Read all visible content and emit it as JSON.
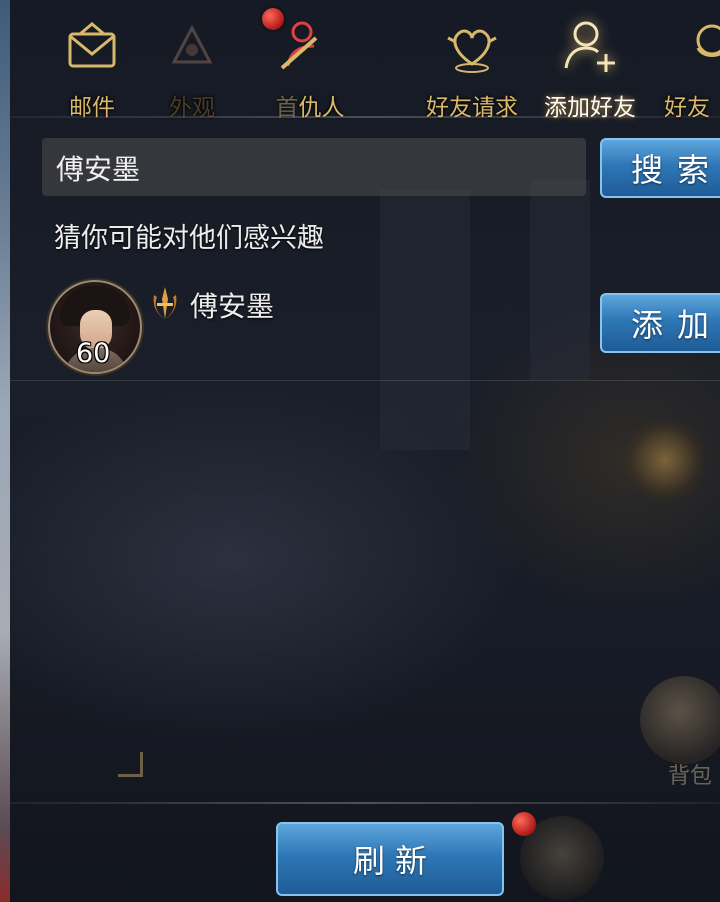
{
  "tabs": [
    {
      "label": "邮件",
      "icon": "mail-icon",
      "state": "normal"
    },
    {
      "label": "外观",
      "icon": "appearance-icon",
      "state": "dim"
    },
    {
      "label": "仇人",
      "icon": "enemy-icon",
      "state": "normal",
      "prefix": "首"
    },
    {
      "label": "好友请求",
      "icon": "friend-request-icon",
      "state": "normal"
    },
    {
      "label": "添加好友",
      "icon": "add-friend-icon",
      "state": "active"
    },
    {
      "label": "好友",
      "icon": "friends-icon",
      "state": "normal"
    }
  ],
  "search": {
    "value": "傅安墨",
    "button_label": "搜索"
  },
  "suggestions": {
    "title": "猜你可能对他们感兴趣",
    "items": [
      {
        "name": "傅安墨",
        "level": "60",
        "add_label": "添加"
      }
    ]
  },
  "footer": {
    "refresh_label": "刷新"
  },
  "hud": {
    "bag_label": "背包"
  },
  "colors": {
    "tab_gold": "#d9b86a",
    "button_blue": "#2e77b6",
    "notification_red": "#b01818"
  }
}
